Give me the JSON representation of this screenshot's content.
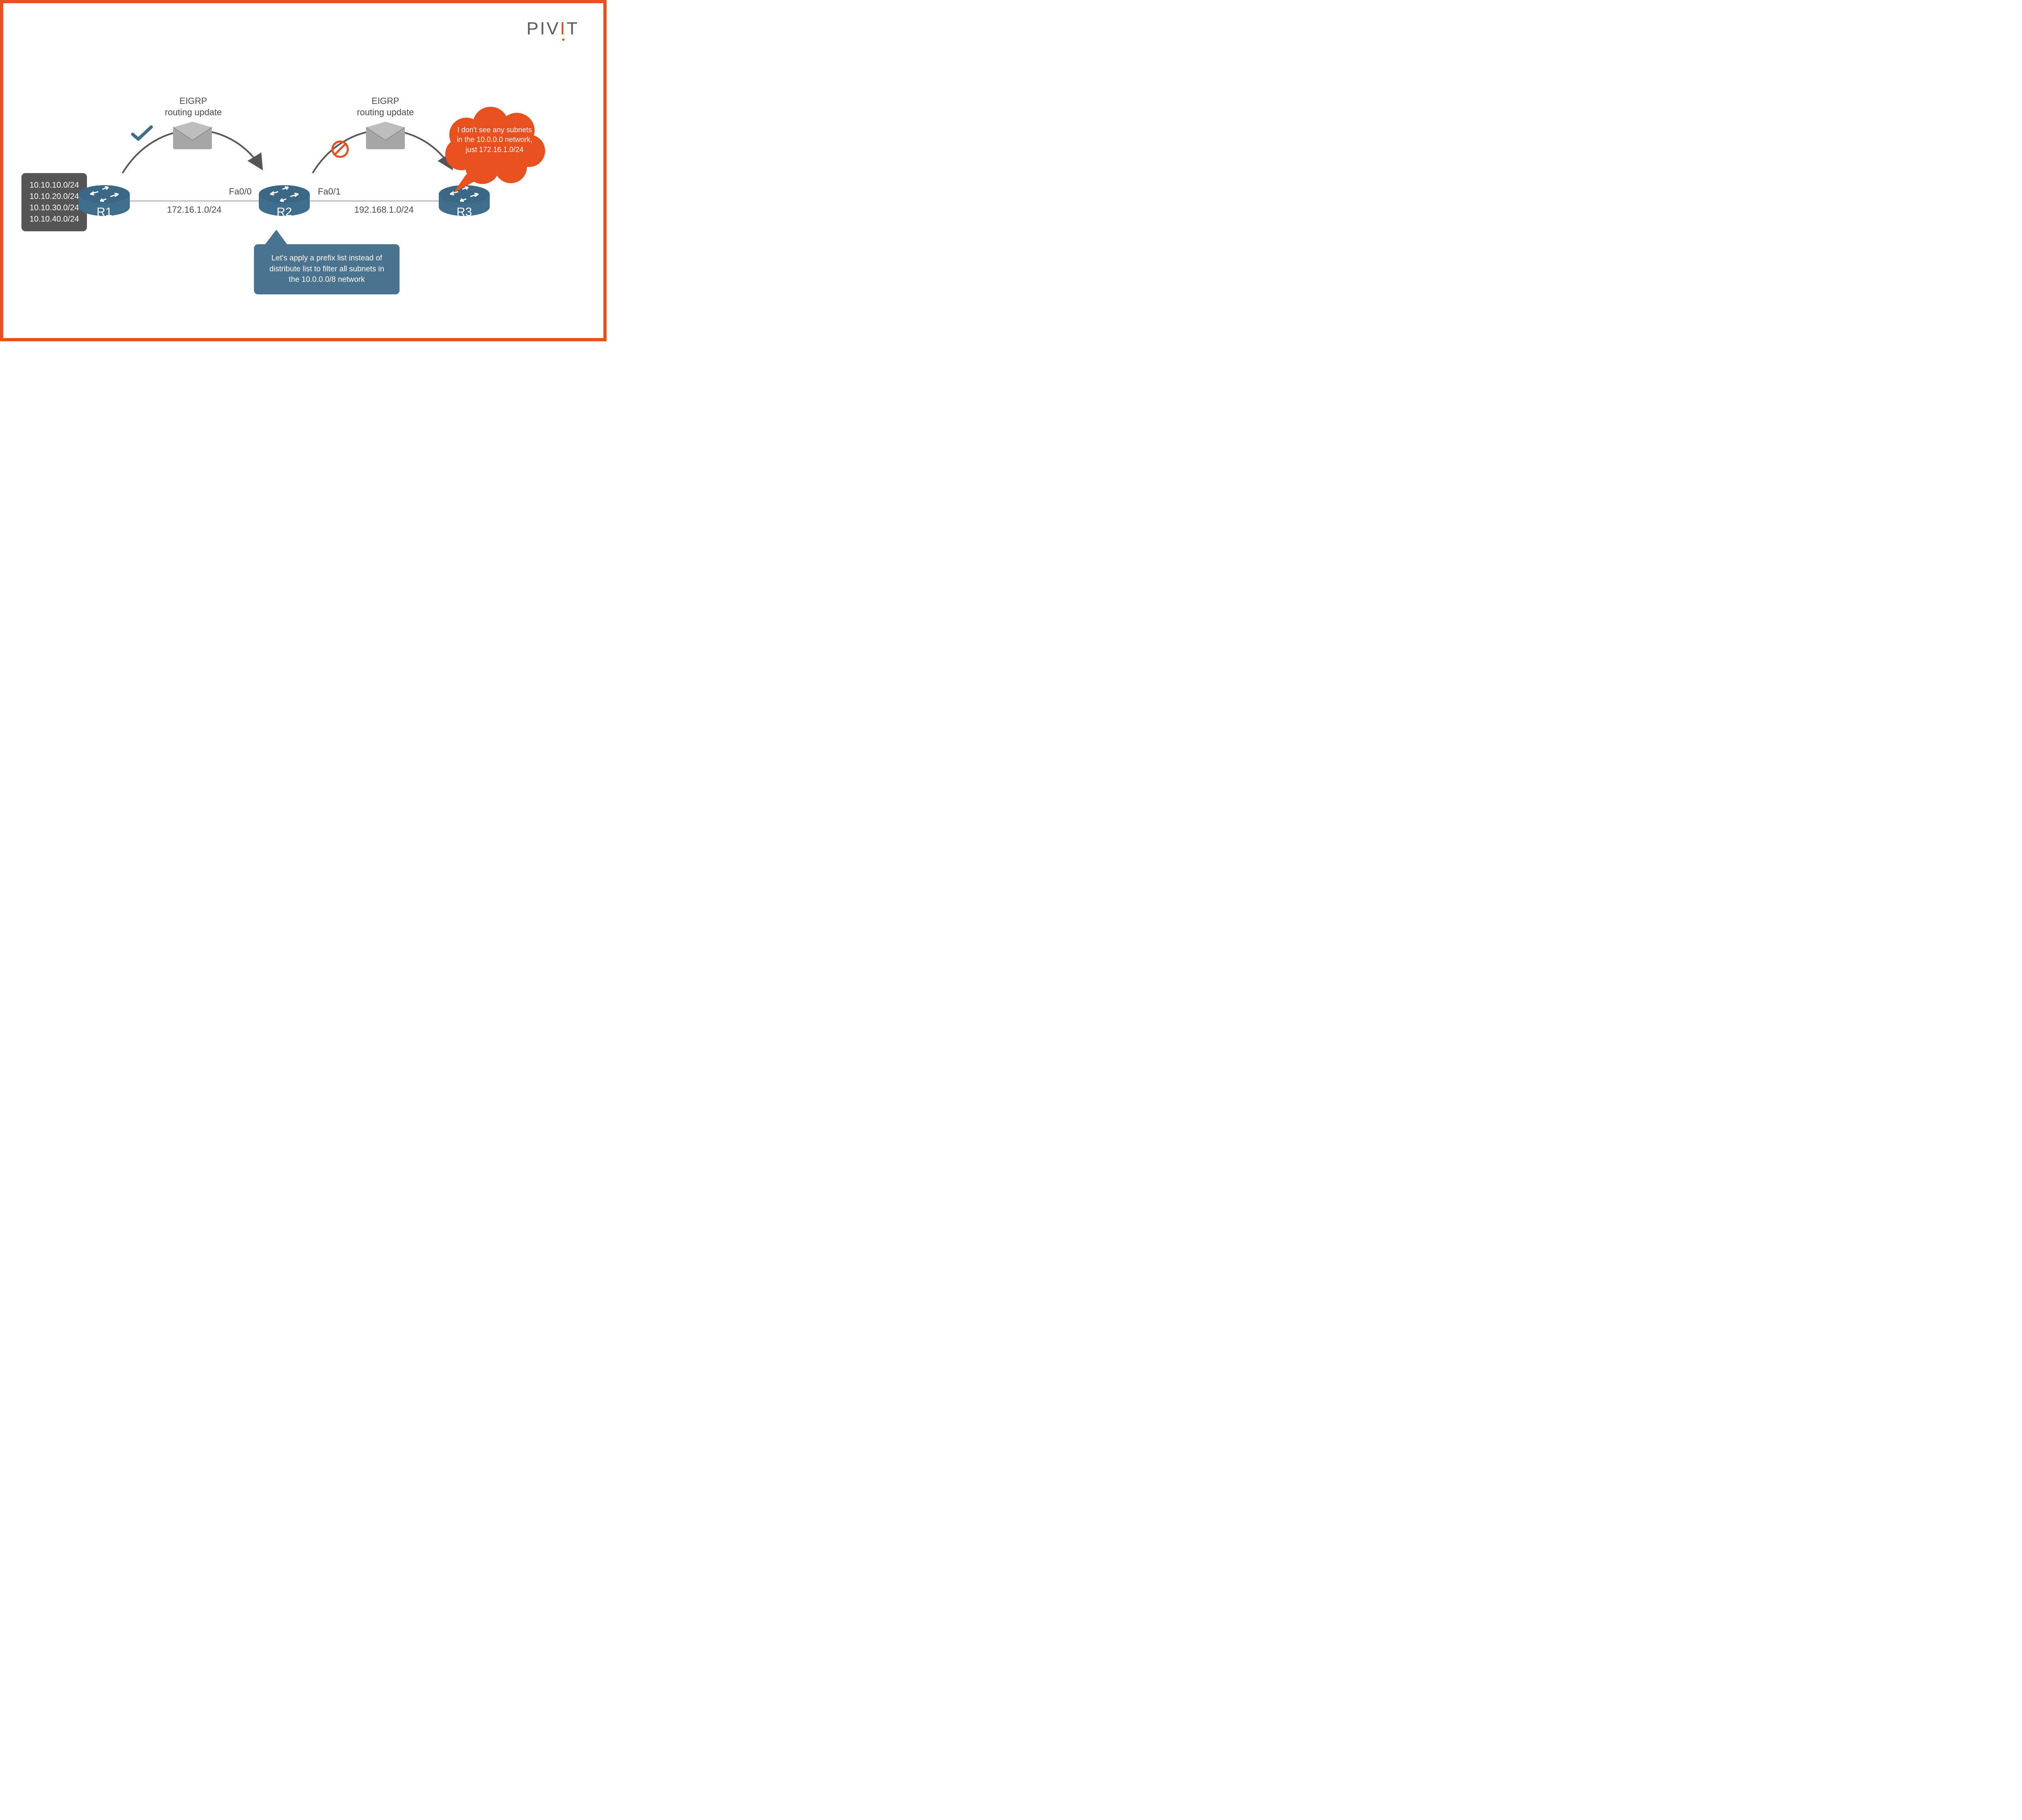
{
  "brand": {
    "name": "PIVIT"
  },
  "routers": {
    "r1": {
      "label": "R1"
    },
    "r2": {
      "label": "R2"
    },
    "r3": {
      "label": "R3"
    }
  },
  "links": {
    "r1_r2": {
      "network": "172.16.1.0/24",
      "r2_iface": "Fa0/0"
    },
    "r2_r3": {
      "network": "192.168.1.0/24",
      "r2_iface": "Fa0/1"
    }
  },
  "r1_subnets": [
    "10.10.10.0/24",
    "10.10.20.0/24",
    "10.10.30.0/24",
    "10.10.40.0/24"
  ],
  "updates": {
    "left": {
      "line1": "EIGRP",
      "line2": "routing update",
      "status": "allowed"
    },
    "right": {
      "line1": "EIGRP",
      "line2": "routing update",
      "status": "denied"
    }
  },
  "r2_speech": "Let's apply a prefix list instead of distribute list to filter all subnets in the 10.0.0.0/8 network",
  "r3_thought": "I don't see any subnets in the 10.0.0.0 network, just 172.16.1.0/24",
  "colors": {
    "accent": "#e8501e",
    "router": "#3f6e8c",
    "router_top": "#3a6784",
    "link": "#c9c9c9",
    "box": "#555555",
    "speech": "#4a7390",
    "envelope": "#a6a6a6",
    "check": "#3f6e8c",
    "deny": "#e8501e"
  }
}
